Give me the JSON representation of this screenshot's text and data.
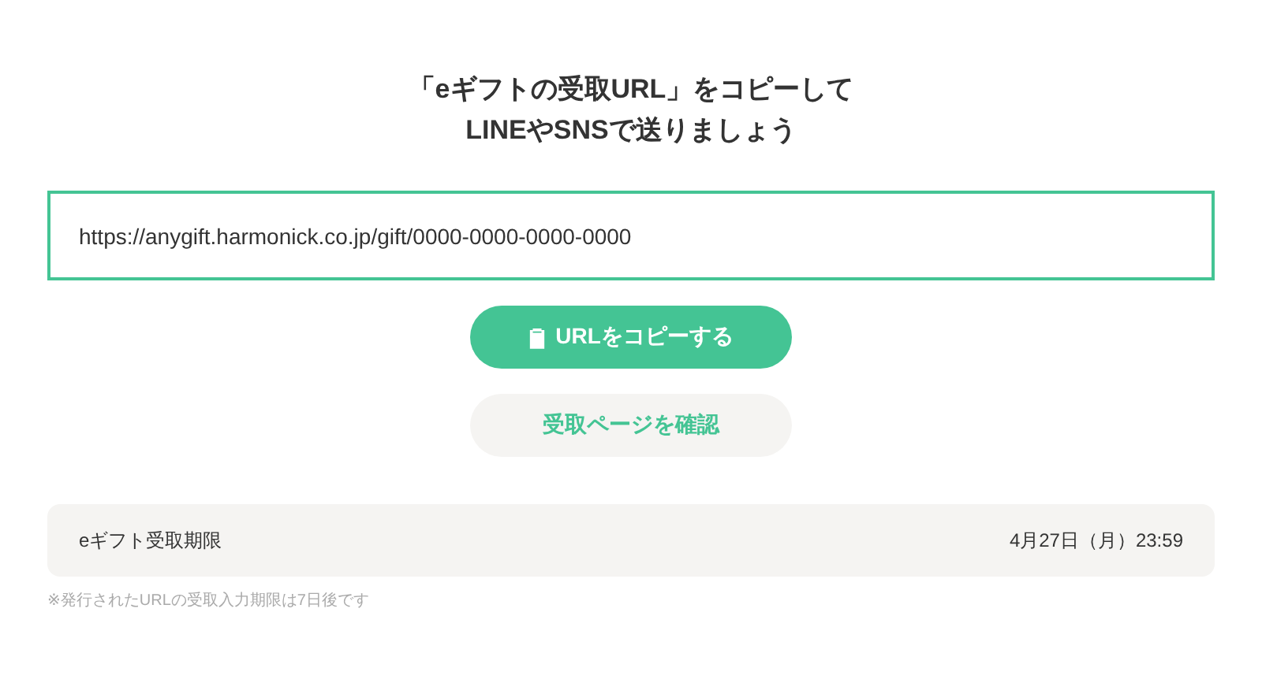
{
  "heading": {
    "lines": [
      "「eギフトの受取URL」をコピーして",
      "LINEやSNSで送りましょう"
    ]
  },
  "url_field": {
    "value": "https://anygift.harmonick.co.jp/gift/0000-0000-0000-0000"
  },
  "buttons": [
    {
      "kind": "primary",
      "label": "URLをコピーする"
    },
    {
      "kind": "secondary",
      "label": "受取ページを確認"
    }
  ],
  "deadline": {
    "label": "eギフト受取期限",
    "value": "4月27日（月）23:59"
  },
  "note": "※発行されたURLの受取入力期限は7日後です"
}
